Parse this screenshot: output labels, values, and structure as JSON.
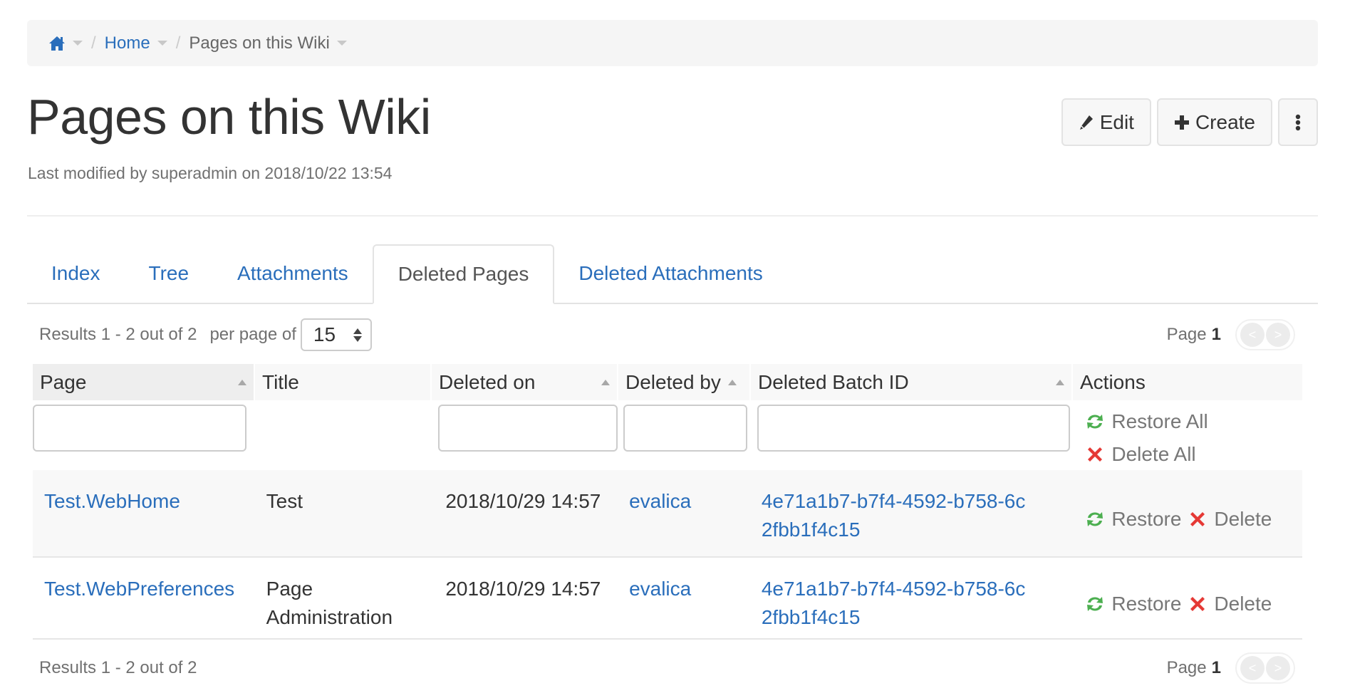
{
  "breadcrumb": {
    "home_icon": "home-icon",
    "items": [
      {
        "label": "Home"
      },
      {
        "label": "Pages on this Wiki"
      }
    ]
  },
  "header": {
    "title": "Pages on this Wiki",
    "meta": "Last modified by superadmin on 2018/10/22 13:54",
    "buttons": {
      "edit": "Edit",
      "create": "Create",
      "more_icon": "vertical-ellipsis-icon"
    }
  },
  "tabs": [
    {
      "label": "Index",
      "active": false
    },
    {
      "label": "Tree",
      "active": false
    },
    {
      "label": "Attachments",
      "active": false
    },
    {
      "label": "Deleted Pages",
      "active": true
    },
    {
      "label": "Deleted Attachments",
      "active": false
    }
  ],
  "results": {
    "summary": "Results 1 - 2 out of 2",
    "per_page_label": "per page of",
    "per_page_value": "15",
    "page_label": "Page",
    "page_number": "1",
    "prev_glyph": "<",
    "next_glyph": ">"
  },
  "table": {
    "columns": [
      {
        "label": "Page",
        "sortable": true,
        "sorted": true
      },
      {
        "label": "Title",
        "sortable": false
      },
      {
        "label": "Deleted on",
        "sortable": true
      },
      {
        "label": "Deleted by",
        "sortable": true
      },
      {
        "label": "Deleted Batch ID",
        "sortable": true
      },
      {
        "label": "Actions",
        "sortable": false
      }
    ],
    "filters": {
      "page": "",
      "deleted_on": "",
      "deleted_by": "",
      "batch_id": ""
    },
    "bulk_actions": {
      "restore_all": "Restore All",
      "delete_all": "Delete All"
    },
    "rows": [
      {
        "page": "Test.WebHome",
        "title": "Test",
        "deleted_on": "2018/10/29 14:57",
        "deleted_by": "evalica",
        "batch_id": "4e71a1b7-b7f4-4592-b758-6c2fbb1f4c15",
        "restore": "Restore",
        "delete": "Delete"
      },
      {
        "page": "Test.WebPreferences",
        "title": "Page Administration",
        "deleted_on": "2018/10/29 14:57",
        "deleted_by": "evalica",
        "batch_id": "4e71a1b7-b7f4-4592-b758-6c2fbb1f4c15",
        "restore": "Restore",
        "delete": "Delete"
      }
    ]
  },
  "colors": {
    "link": "#2a6ebb",
    "restore_icon": "#4caf50",
    "delete_icon": "#e53935"
  }
}
